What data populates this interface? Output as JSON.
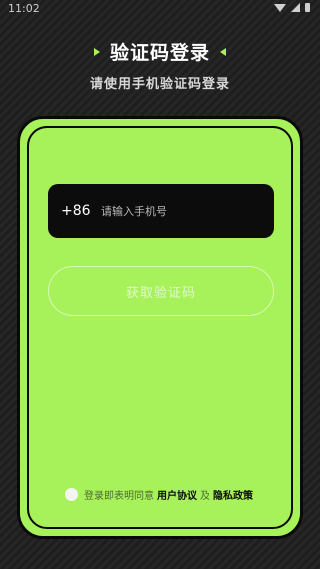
{
  "status_bar": {
    "time": "11:02",
    "icons": [
      "wifi-icon",
      "signal-icon",
      "battery-icon"
    ]
  },
  "header": {
    "title": "验证码登录",
    "subtitle": "请使用手机验证码登录"
  },
  "form": {
    "country_code": "+86",
    "phone_placeholder": "请输入手机号",
    "get_code_label": "获取验证码"
  },
  "agreement": {
    "prefix": "登录即表明同意",
    "user_agreement": "用户协议",
    "and": "及",
    "privacy_policy": "隐私政策"
  },
  "colors": {
    "accent": "#a7f25b",
    "background": "#1e1e1e",
    "input_bg": "#0c0c0c"
  }
}
